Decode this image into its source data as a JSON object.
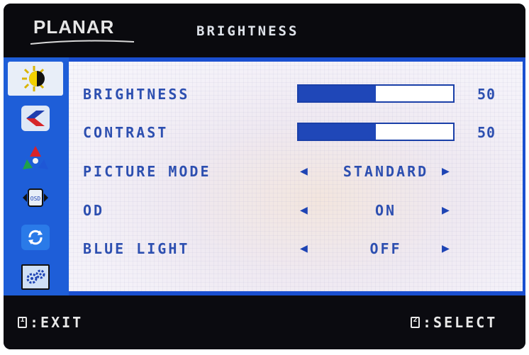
{
  "header": {
    "logo": "PLANAR",
    "title": "BRIGHTNESS"
  },
  "sidebar": {
    "items": [
      {
        "icon": "brightness-icon",
        "active": true
      },
      {
        "icon": "image-settings-icon",
        "active": false
      },
      {
        "icon": "color-icon",
        "active": false
      },
      {
        "icon": "osd-settings-icon",
        "active": false
      },
      {
        "icon": "reset-icon",
        "active": false
      },
      {
        "icon": "setup-icon",
        "active": false
      }
    ]
  },
  "menu": {
    "brightness": {
      "label": "BRIGHTNESS",
      "value": "50",
      "level": 0.5
    },
    "contrast": {
      "label": "CONTRAST",
      "value": "50",
      "level": 0.5
    },
    "picture_mode": {
      "label": "PICTURE MODE",
      "value": "STANDARD"
    },
    "od": {
      "label": "OD",
      "value": "ON"
    },
    "blue_light": {
      "label": "BLUE LIGHT",
      "value": "OFF"
    }
  },
  "footer": {
    "exit_key": "1",
    "exit_label": ":EXIT",
    "select_key": "2",
    "select_label": ":SELECT"
  },
  "colors": {
    "frame_blue": "#1a4fd0",
    "text_blue": "#2d4fb0",
    "bar_fill": "#1f47b8",
    "background": "#0b0b10"
  }
}
